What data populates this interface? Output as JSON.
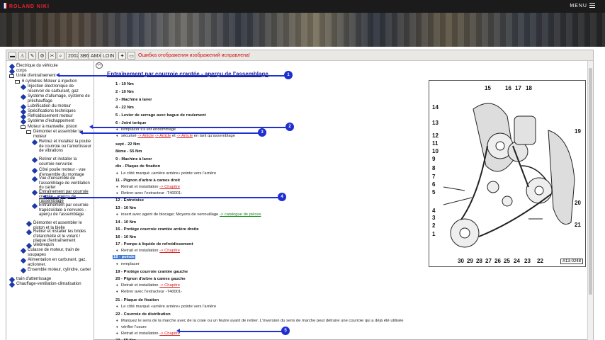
{
  "header": {
    "brand": "ROLAND NIKI",
    "menu_label": "MENU"
  },
  "toolbar": {
    "btn_2002": "2002",
    "btn_3b6": "3B6",
    "btn_amx": "AMX",
    "btn_loin": "LOIN",
    "error_text": "Ошибка отображения изображений исправлена!"
  },
  "tree": {
    "items": [
      "Électrique du véhicule",
      "corps",
      "Unité d'entraînement",
      "6 cylindres Moteur à injection",
      "Injection électronique de réservoir de carburant, gaz",
      "Système d'allumage, système de préchauffage",
      "Lubrification du moteur",
      "Spécifications techniques",
      "Refroidissement moteur",
      "Système d'échappement",
      "Moteur à manivelle, piston",
      "Démonter et assembler le moteur",
      "Retirez et installez la poulie de courroie ou l'amortisseur de vibrations",
      "Retirer et installer la courroie nervurée",
      "Côté poulie moteur - vue d'ensemble du montage",
      "Vue d'ensemble de l'assemblage de ventilation du carter",
      "Entraînement par courroie crantée - aperçu de l'assemblage",
      "Entraînement par courroie trapézoïdale à nervures - aperçu de l'assemblage",
      "Démonter et assembler le piston et la bielle",
      "Retirer et installer les brides d'étanchéité et le volant / plaque d'entraînement",
      "vilebrequin",
      "Culasse de moteur, train de soupapes",
      "Alimentation en carburant, gaz, actionner.",
      "Ensemble moteur, cylindre, carter",
      "train d'atterrissage",
      "Chauffage-ventilation-climatisation"
    ],
    "collapse_label": "<<"
  },
  "document": {
    "title": "Entraînement par courroie crantée - aperçu de l'assemblage",
    "lines": [
      {
        "kind": "step",
        "text": "1 - 10 Nm"
      },
      {
        "kind": "step",
        "text": "2 - 10 Nm"
      },
      {
        "kind": "step",
        "text": "3 - Machine à laver"
      },
      {
        "kind": "step",
        "text": "4 - 22 Nm"
      },
      {
        "kind": "step",
        "text": "5 - Levier de serrage avec bague de roulement"
      },
      {
        "kind": "step",
        "text": "6 - Joint torique"
      },
      {
        "kind": "note",
        "text": "remplacer s'il est endommagé"
      },
      {
        "kind": "note",
        "text": "sécurisé",
        "link": "-> Article",
        "link2": "-> Article",
        "text2": "et",
        "link3": "-> Article",
        "text3": "en tant qu'assemblage"
      },
      {
        "kind": "step",
        "text": "sept - 22 Nm"
      },
      {
        "kind": "step",
        "text": "8ème - 55 Nm"
      },
      {
        "kind": "step",
        "text": "9 - Machine à laver"
      },
      {
        "kind": "step",
        "text": "dix - Plaque de fixation"
      },
      {
        "kind": "note",
        "text": "Le côté marqué «arrière arrière» pointe vers l'arrière"
      },
      {
        "kind": "step",
        "text": "11 - Pignon d'arbre à cames droit"
      },
      {
        "kind": "note",
        "text": "Retrait et installation",
        "link": "-> Chapitre"
      },
      {
        "kind": "note",
        "text": "Retirer avec l'extracteur -T40001-"
      },
      {
        "kind": "step",
        "text": "12 - Entretoise"
      },
      {
        "kind": "step",
        "text": "13 - 10 Nm"
      },
      {
        "kind": "note",
        "text": "insert avec agent de blocage; Moyens de verrouillage",
        "green": "-> catalogue de pièces"
      },
      {
        "kind": "step",
        "text": "14 - 10 Nm"
      },
      {
        "kind": "step",
        "text": "15 - Protège courroie crantée arrière droite"
      },
      {
        "kind": "step",
        "text": "16 - 10 Nm"
      },
      {
        "kind": "step",
        "text": "17 - Pompe à liquide de refroidissement"
      },
      {
        "kind": "note",
        "text": "Retrait et installation",
        "link": "-> Chapitre"
      },
      {
        "kind": "step",
        "text": "18 - poésie",
        "highlight": true
      },
      {
        "kind": "note",
        "text": "remplacer"
      },
      {
        "kind": "step",
        "text": "19 - Protège courroie crantée gauche"
      },
      {
        "kind": "step",
        "text": "20 - Pignon d'arbre à cames gauche"
      },
      {
        "kind": "note",
        "text": "Retrait et installation",
        "link": "-> Chapitre"
      },
      {
        "kind": "note",
        "text": "Retirer avec l'extracteur -T40001-"
      },
      {
        "kind": "step",
        "text": "21 - Plaque de fixation"
      },
      {
        "kind": "note",
        "text": "Le côté marqué «arrière arrière» pointe vers l'arrière"
      },
      {
        "kind": "step",
        "text": "22 - Courroie de distribution"
      },
      {
        "kind": "note",
        "text": "Marquez le sens de la marche avec de la craie ou un feutre avant de retirer. L'inversion du sens de marche peut détruire une courroie qui a déjà été utilisée"
      },
      {
        "kind": "note",
        "text": "vérifier l'usure"
      },
      {
        "kind": "note",
        "text": "Retrait et installation",
        "link": "-> Chapitre"
      },
      {
        "kind": "step",
        "text": "23 - 55 Nm"
      }
    ]
  },
  "callouts": [
    "1",
    "2",
    "3",
    "4",
    "5"
  ],
  "figure": {
    "code": "A13-0248",
    "labels": [
      "15",
      "16",
      "17",
      "18",
      "14",
      "13",
      "12",
      "11",
      "10",
      "9",
      "8",
      "7",
      "6",
      "5",
      "4",
      "3",
      "2",
      "1",
      "19",
      "20",
      "21",
      "30",
      "29",
      "28",
      "27",
      "26",
      "25",
      "24",
      "23",
      "22"
    ]
  },
  "colors": {
    "accent": "#1f2fd0",
    "link_red": "#d62020",
    "link_green": "#11851a",
    "title_blue": "#1a1a8a"
  }
}
